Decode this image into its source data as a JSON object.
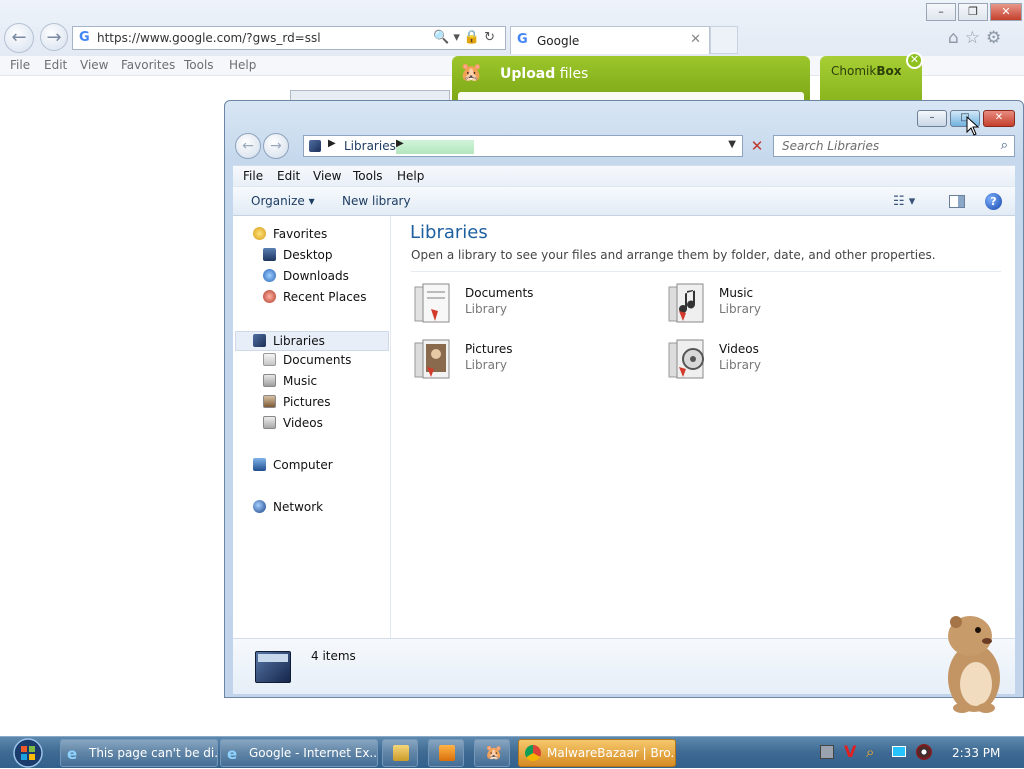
{
  "browser": {
    "url": "https://www.google.com/?gws_rd=ssl",
    "tab_title": "Google",
    "menu": [
      "File",
      "Edit",
      "View",
      "Favorites",
      "Tools",
      "Help"
    ]
  },
  "uploader": {
    "title_bold": "Upload",
    "title_rest": " files",
    "chomik_bold": "Box",
    "chomik_prefix": "Chomik"
  },
  "explorer": {
    "breadcrumb": "Libraries",
    "search_placeholder": "Search Libraries",
    "menu": [
      "File",
      "Edit",
      "View",
      "Tools",
      "Help"
    ],
    "commands": {
      "organize": "Organize",
      "new_library": "New library"
    },
    "nav": {
      "favorites": "Favorites",
      "desktop": "Desktop",
      "downloads": "Downloads",
      "recent": "Recent Places",
      "libraries": "Libraries",
      "documents": "Documents",
      "music": "Music",
      "pictures": "Pictures",
      "videos": "Videos",
      "computer": "Computer",
      "network": "Network"
    },
    "content": {
      "title": "Libraries",
      "subtitle": "Open a library to see your files and arrange them by folder, date, and other properties.",
      "items": [
        {
          "name": "Documents",
          "kind": "Library"
        },
        {
          "name": "Music",
          "kind": "Library"
        },
        {
          "name": "Pictures",
          "kind": "Library"
        },
        {
          "name": "Videos",
          "kind": "Library"
        }
      ]
    },
    "status": {
      "count": "4 items"
    }
  },
  "taskbar": {
    "tasks": [
      "This page can't be di...",
      "Google - Internet Ex...",
      "MalwareBazaar | Bro..."
    ],
    "clock": "2:33 PM"
  }
}
